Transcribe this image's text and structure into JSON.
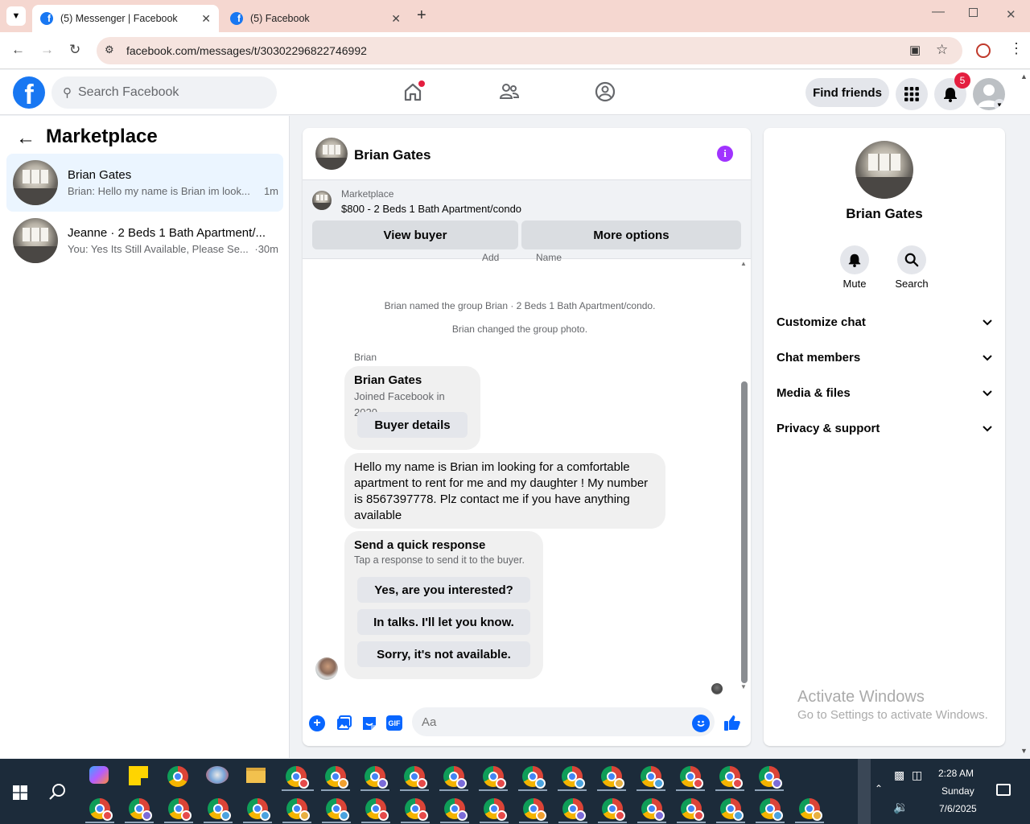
{
  "browser": {
    "tabs": [
      {
        "title": "(5) Messenger | Facebook",
        "active": true
      },
      {
        "title": "(5) Facebook",
        "active": false
      }
    ],
    "url": "facebook.com/messages/t/30302296822746992"
  },
  "header": {
    "search_placeholder": "Search Facebook",
    "find_friends": "Find friends",
    "notification_count": "5"
  },
  "sidebar": {
    "title": "Marketplace",
    "conversations": [
      {
        "name": "Brian Gates",
        "preview": "Brian: Hello my name is Brian im look...",
        "time": "1m",
        "selected": true
      },
      {
        "name": "Jeanne · 2 Beds 1 Bath Apartment/...",
        "preview": "You: Yes Its Still Available, Please Se...",
        "time": "·30m",
        "selected": false
      }
    ]
  },
  "chat": {
    "contact_name": "Brian Gates",
    "marketplace_label": "Marketplace",
    "listing": "$800 - 2 Beds 1 Bath Apartment/condo",
    "view_buyer": "View buyer",
    "more_options": "More options",
    "partial_add": "Add",
    "partial_name": "Name",
    "system_messages": [
      "Brian named the group Brian · 2 Beds 1 Bath Apartment/condo.",
      "Brian changed the group photo."
    ],
    "sender_label": "Brian",
    "profile_card": {
      "name": "Brian Gates",
      "joined": "Joined Facebook in 2020",
      "button": "Buyer details"
    },
    "message": "Hello my name is Brian  im looking for a comfortable apartment to rent for me and my daughter !   My number is 8567397778. Plz contact me if you have anything available",
    "quick_response": {
      "title": "Send a quick response",
      "subtitle": "Tap a response to send it to the buyer.",
      "options": [
        "Yes, are you interested?",
        "In talks. I'll let you know.",
        "Sorry, it's not available."
      ]
    },
    "composer_placeholder": "Aa",
    "gif_label": "GIF"
  },
  "info_panel": {
    "name": "Brian Gates",
    "mute_label": "Mute",
    "search_label": "Search",
    "sections": [
      "Customize chat",
      "Chat members",
      "Media & files",
      "Privacy & support"
    ]
  },
  "watermark": {
    "line1": "Activate Windows",
    "line2": "Go to Settings to activate Windows."
  },
  "taskbar": {
    "time": "2:28 AM",
    "day": "Sunday",
    "date": "7/6/2025"
  },
  "colors": {
    "facebook_blue": "#1877f2",
    "messenger_blue": "#0866ff",
    "chat_info_purple": "#a033ff",
    "notification_red": "#e41e3f"
  }
}
